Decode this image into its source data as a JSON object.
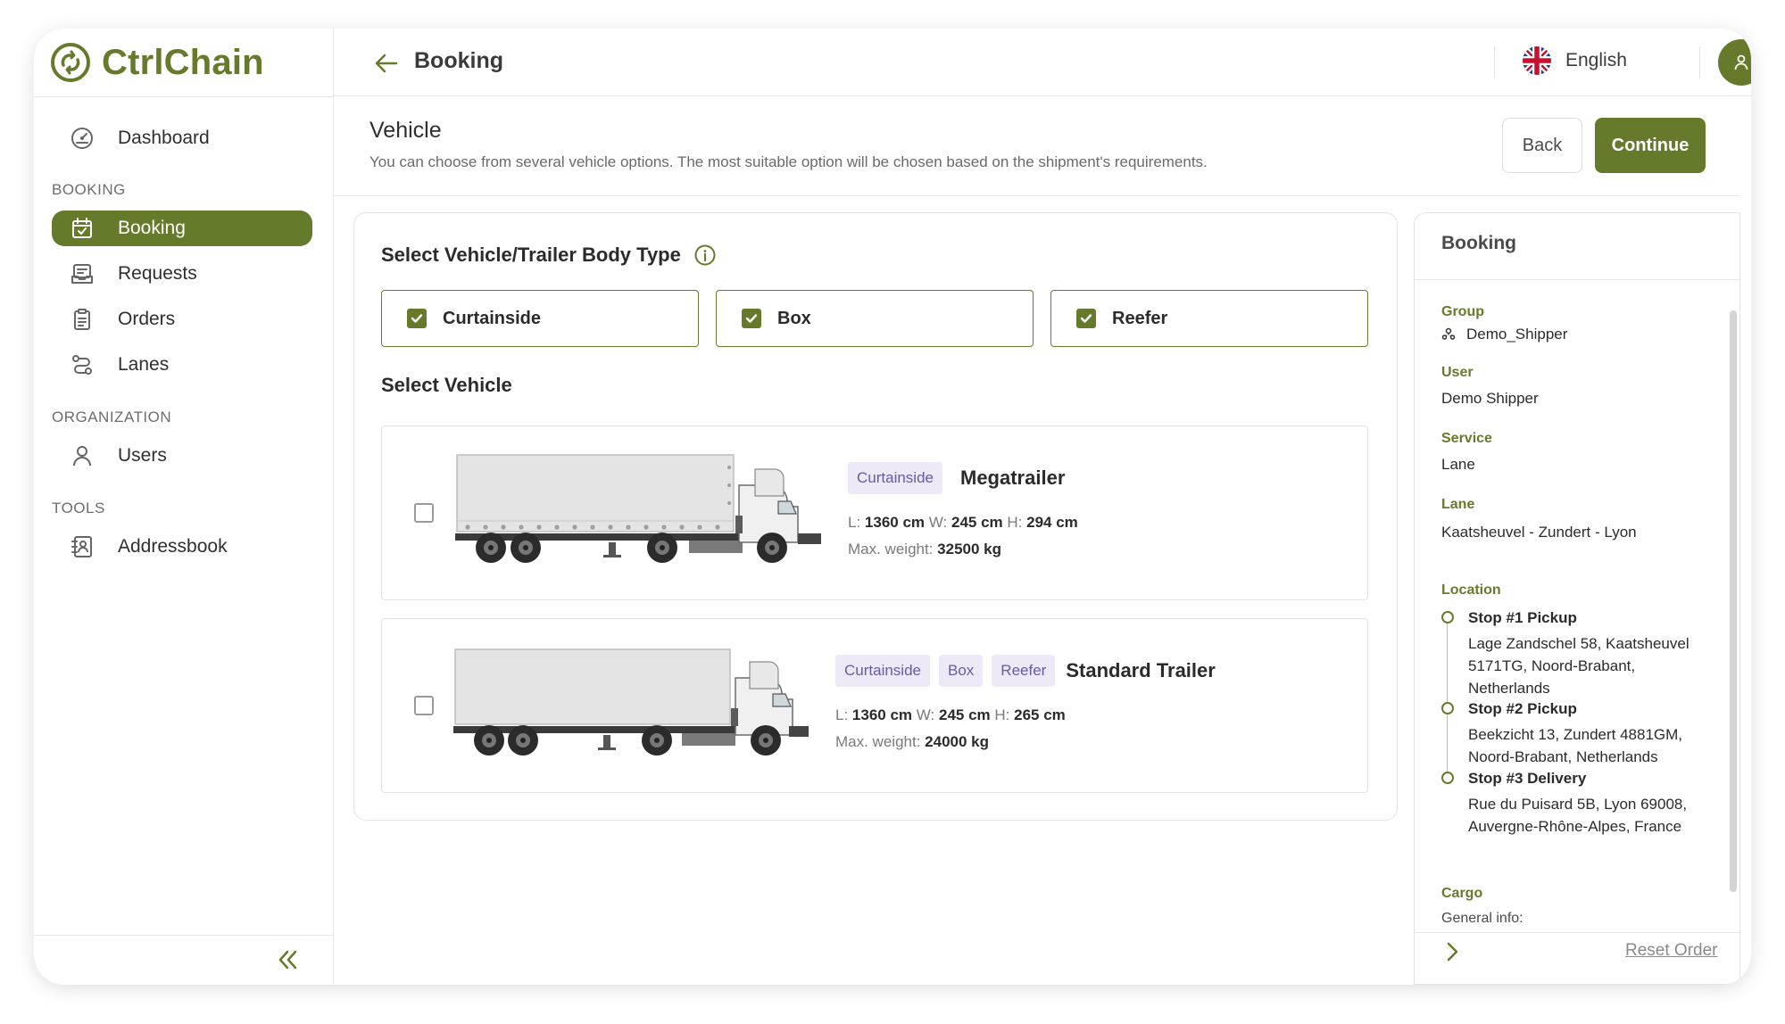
{
  "brand": {
    "name": "CtrlChain",
    "color": "#667a2c"
  },
  "sidebar": {
    "dashboard": "Dashboard",
    "sections": {
      "booking": "BOOKING",
      "organization": "ORGANIZATION",
      "tools": "TOOLS"
    },
    "items": {
      "booking": "Booking",
      "requests": "Requests",
      "orders": "Orders",
      "lanes": "Lanes",
      "users": "Users",
      "addressbook": "Addressbook"
    },
    "active": "Booking"
  },
  "header": {
    "title": "Booking",
    "language": "English"
  },
  "subheader": {
    "title": "Vehicle",
    "description": "You can choose from several vehicle options. The most suitable option will be chosen based on the shipment's requirements.",
    "back_label": "Back",
    "continue_label": "Continue"
  },
  "body_type": {
    "title": "Select Vehicle/Trailer Body Type",
    "options": [
      {
        "label": "Curtainside",
        "checked": true
      },
      {
        "label": "Box",
        "checked": true
      },
      {
        "label": "Reefer",
        "checked": true
      }
    ]
  },
  "vehicles": {
    "title": "Select Vehicle",
    "list": [
      {
        "name": "Megatrailer",
        "tags": [
          "Curtainside"
        ],
        "l_label": "L:",
        "l": "1360 cm",
        "w_label": "W:",
        "w": "245 cm",
        "h_label": "H:",
        "h": "294 cm",
        "weight_label": "Max. weight:",
        "weight": "32500 kg",
        "selected": false
      },
      {
        "name": "Standard Trailer",
        "tags": [
          "Curtainside",
          "Box",
          "Reefer"
        ],
        "l_label": "L:",
        "l": "1360 cm",
        "w_label": "W:",
        "w": "245 cm",
        "h_label": "H:",
        "h": "265 cm",
        "weight_label": "Max. weight:",
        "weight": "24000 kg",
        "selected": false
      }
    ]
  },
  "summary": {
    "title": "Booking",
    "group_label": "Group",
    "group": "Demo_Shipper",
    "user_label": "User",
    "user": "Demo Shipper",
    "service_label": "Service",
    "service": "Lane",
    "lane_label": "Lane",
    "lane": "Kaatsheuvel - Zundert - Lyon",
    "location_label": "Location",
    "stops": [
      {
        "title": "Stop #1 Pickup",
        "address": "Lage Zandschel 58, Kaatsheuvel 5171TG, Noord-Brabant, Netherlands"
      },
      {
        "title": "Stop #2 Pickup",
        "address": "Beekzicht 13, Zundert 4881GM, Noord-Brabant, Netherlands"
      },
      {
        "title": "Stop #3 Delivery",
        "address": "Rue du Puisard 5B, Lyon 69008, Auvergne-Rhône-Alpes, France"
      }
    ],
    "cargo_label": "Cargo",
    "cargo_general": "General info:",
    "reset_label": "Reset Order"
  }
}
